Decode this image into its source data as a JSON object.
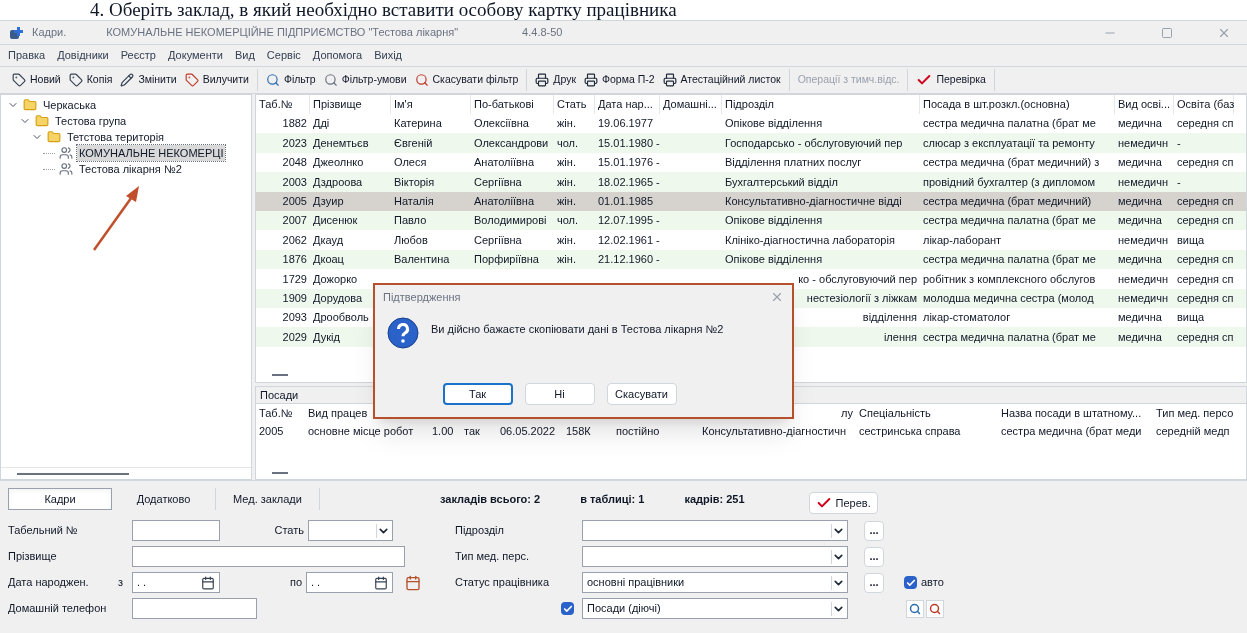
{
  "document_heading": "4. Оберіть заклад, в який необхідно вставити особову картку працівника",
  "window": {
    "app_name": "Кадри.",
    "title": "КОМУНАЛЬНЕ НЕКОМЕРЦІЙНЕ ПІДПРИЄМСТВО \"Тестова лікарня\"",
    "version": "4.4.8-50"
  },
  "menu": [
    "Правка",
    "Довідники",
    "Реєстр",
    "Документи",
    "Вид",
    "Сервіс",
    "Допомога",
    "Вихід"
  ],
  "toolbar": [
    [
      {
        "label": "Новий",
        "kind": "tag",
        "disabled": false
      },
      {
        "label": "Копія",
        "kind": "tag",
        "disabled": false
      },
      {
        "label": "Змінити",
        "kind": "edit",
        "disabled": false
      },
      {
        "label": "Вилучити",
        "kind": "delete",
        "disabled": false
      }
    ],
    [
      {
        "label": "Фільтр",
        "kind": "search",
        "disabled": false
      },
      {
        "label": "Фільтр-умови",
        "kind": "filter",
        "disabled": false
      },
      {
        "label": "Скасувати фільтр",
        "kind": "search-cancel",
        "disabled": false
      }
    ],
    [
      {
        "label": "Друк",
        "kind": "print",
        "disabled": false
      },
      {
        "label": "Форма П-2",
        "kind": "print",
        "disabled": false
      },
      {
        "label": "Атестаційний листок",
        "kind": "print",
        "disabled": false
      }
    ],
    [
      {
        "label": "Операції з тимч.відс.",
        "kind": "text",
        "disabled": true
      }
    ],
    [
      {
        "label": "Перевірка",
        "kind": "check",
        "disabled": false
      }
    ]
  ],
  "tree": [
    {
      "label": "Черкаська",
      "expanded": true,
      "children": [
        {
          "label": "Тестова група",
          "expanded": true,
          "children": [
            {
              "label": "Тетстова територія",
              "expanded": true,
              "children": [
                {
                  "label": "КОМУНАЛЬНЕ НЕКОМЕРЦІ",
                  "selected": true
                },
                {
                  "label": "Тестова лікарня №2",
                  "selected": false
                }
              ]
            }
          ]
        }
      ]
    }
  ],
  "staff_table": {
    "columns": [
      "Таб.№",
      "Прізвище",
      "Ім'я",
      "По-батькові",
      "Стать",
      "Дата нар...",
      "Домашні...",
      "Підрозділ",
      "Посада в шт.розкл.(основна)",
      "Вид осві...",
      "Освіта (баз"
    ],
    "rows": [
      {
        "selected": false,
        "cells": [
          "1882",
          "Дді",
          "Катерина",
          "Олексіївна",
          "жін.",
          "19.06.1977",
          null,
          "Опікове відділення",
          "сестра медична палатна (брат ме",
          "медична",
          "середня сп"
        ]
      },
      {
        "selected": false,
        "cells": [
          "2023",
          "Денемтьєв",
          "Євгеній",
          "Олександрови",
          "чол.",
          "15.01.1980 -",
          null,
          "Господарсько - обслуговуючий пер",
          "слюсар з експлуатації та ремонту",
          "немедичн",
          "-"
        ]
      },
      {
        "selected": false,
        "cells": [
          "2048",
          "Джеолнко",
          "Олеся",
          "Анатоліївна",
          "жін.",
          "15.01.1976 -",
          null,
          "Відділення платних послуг",
          "сестра медична (брат медичний) з",
          "медична",
          "середня сп"
        ]
      },
      {
        "selected": false,
        "cells": [
          "2003",
          "Дздроова",
          "Вікторія",
          "Сергіївна",
          "жін.",
          "18.02.1965 -",
          null,
          "Бухгалтерський відділ",
          "провідний бухгалтер (з дипломом",
          "немедичн",
          "-"
        ]
      },
      {
        "selected": true,
        "cells": [
          "2005",
          "Дзуир",
          "Наталія",
          "Анатоліївна",
          "жін.",
          "01.01.1985",
          null,
          "Консультативно-діагностичне відді",
          "сестра медична (брат медичний)",
          "медична",
          "середня сп"
        ]
      },
      {
        "selected": false,
        "cells": [
          "2007",
          "Дисенюк",
          "Павло",
          "Володимирові",
          "чол.",
          "12.07.1995 -",
          null,
          "Опікове відділення",
          "сестра медична палатна (брат ме",
          "медична",
          "середня сп"
        ]
      },
      {
        "selected": false,
        "cells": [
          "2062",
          "Дкауд",
          "Любов",
          "Сергіївна",
          "жін.",
          "12.02.1961 -",
          null,
          "Клініко-діагностична лабораторія",
          "лікар-лаборант",
          "немедичн",
          "вища"
        ]
      },
      {
        "selected": false,
        "cells": [
          "1876",
          "Дкоац",
          "Валентина",
          "Порфиріївна",
          "жін.",
          "21.12.1960 -",
          null,
          "Опікове відділення",
          "сестра медична палатна (брат ме",
          "медична",
          "середня сп"
        ]
      },
      {
        "selected": false,
        "cells": [
          "1729",
          "Дожорко",
          null,
          null,
          null,
          null,
          null,
          "ко - обслуговуючий пер",
          "робітник з комплексного обслугов",
          "немедичн",
          "середня сп"
        ]
      },
      {
        "selected": false,
        "cells": [
          "1909",
          "Дорудова",
          null,
          null,
          null,
          null,
          null,
          "нестезіології з ліжкам",
          "молодша медична сестра (молод",
          "немедичн",
          "середня сп"
        ]
      },
      {
        "selected": false,
        "cells": [
          "2093",
          "Дрообволь",
          null,
          null,
          null,
          null,
          null,
          "відділення",
          "лікар-стоматолог",
          "медична",
          "вища"
        ]
      },
      {
        "selected": false,
        "cells": [
          "2029",
          "Дукід",
          null,
          null,
          null,
          null,
          null,
          "ілення",
          "сестра медична палатна (брат ме",
          "медична",
          "середня сп"
        ]
      }
    ]
  },
  "positions_panel": {
    "title": "Посади",
    "columns": [
      "Таб.№",
      "Вид працев",
      null,
      null,
      null,
      null,
      null,
      "лу",
      "Спеціальність",
      "Назва посади в штатному...",
      "Тип мед. персо"
    ],
    "rows": [
      [
        "2005",
        "основне місце робот",
        "1.00",
        "так",
        "06.05.2022",
        "158К",
        "постійно",
        "Консультативно-діагностичн",
        "сестринська справа",
        "сестра медична (брат меди",
        "середній медп"
      ]
    ]
  },
  "dialog": {
    "title": "Підтвердження",
    "message": "Ви дійсно бажаєте скопіювати дані в Тестова лікарня №2",
    "buttons": [
      {
        "label": "Так",
        "default": true
      },
      {
        "label": "Ні",
        "default": false
      },
      {
        "label": "Скасувати",
        "default": false
      }
    ]
  },
  "form": {
    "tabs": [
      {
        "label": "Кадри",
        "selected": true
      },
      {
        "label": "Додатково",
        "selected": false
      },
      {
        "label": "Мед. заклади",
        "selected": false
      }
    ],
    "stats": [
      "закладів всього: 2",
      "в таблиці: 1",
      "кадрів: 251"
    ],
    "check_button": "Перев.",
    "tab_number": {
      "label": "Табельний №"
    },
    "sex": {
      "label": "Стать"
    },
    "surname": {
      "label": "Прізвище"
    },
    "birth_date": {
      "label": "Дата народжен.",
      "from_label": "з",
      "from_value": ". .",
      "to_label": "по",
      "to_value": ". ."
    },
    "phone": {
      "label": "Домашній телефон"
    },
    "department": {
      "label": "Підрозділ",
      "more": "..."
    },
    "med_staff_type": {
      "label": "Тип мед. перс.",
      "more": "..."
    },
    "employee_status": {
      "label": "Статус працівника",
      "value": "основні працівники",
      "more": "..."
    },
    "positions_filter": {
      "checked": true,
      "value": "Посади (діючі)"
    },
    "auto": {
      "label": "авто",
      "checked": true
    }
  }
}
